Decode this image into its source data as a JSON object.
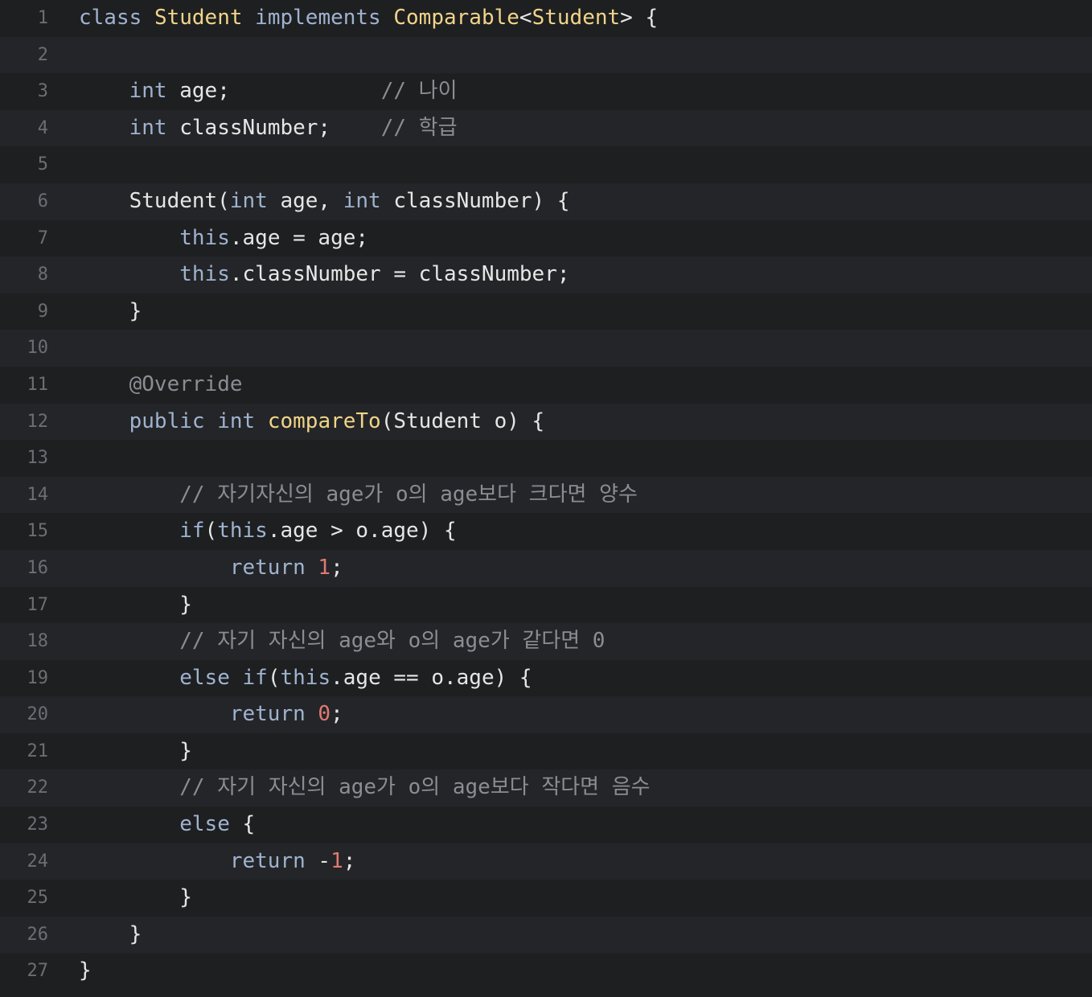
{
  "editor": {
    "language": "java",
    "lines": [
      {
        "n": "1",
        "tokens": [
          {
            "t": "class",
            "c": "kw"
          },
          {
            "t": " ",
            "c": "pl"
          },
          {
            "t": "Student",
            "c": "ty"
          },
          {
            "t": " ",
            "c": "pl"
          },
          {
            "t": "implements",
            "c": "kw"
          },
          {
            "t": " ",
            "c": "pl"
          },
          {
            "t": "Comparable",
            "c": "ty"
          },
          {
            "t": "<",
            "c": "pl"
          },
          {
            "t": "Student",
            "c": "ty"
          },
          {
            "t": "> {",
            "c": "pl"
          }
        ]
      },
      {
        "n": "2",
        "tokens": []
      },
      {
        "n": "3",
        "tokens": [
          {
            "t": "    ",
            "c": "pl"
          },
          {
            "t": "int",
            "c": "kw"
          },
          {
            "t": " age;            ",
            "c": "pl"
          },
          {
            "t": "// 나이",
            "c": "cm"
          }
        ]
      },
      {
        "n": "4",
        "tokens": [
          {
            "t": "    ",
            "c": "pl"
          },
          {
            "t": "int",
            "c": "kw"
          },
          {
            "t": " classNumber;    ",
            "c": "pl"
          },
          {
            "t": "// 학급",
            "c": "cm"
          }
        ]
      },
      {
        "n": "5",
        "tokens": []
      },
      {
        "n": "6",
        "tokens": [
          {
            "t": "    Student(",
            "c": "pl"
          },
          {
            "t": "int",
            "c": "kw"
          },
          {
            "t": " age, ",
            "c": "pl"
          },
          {
            "t": "int",
            "c": "kw"
          },
          {
            "t": " classNumber) {",
            "c": "pl"
          }
        ]
      },
      {
        "n": "7",
        "tokens": [
          {
            "t": "        ",
            "c": "pl"
          },
          {
            "t": "this",
            "c": "kw"
          },
          {
            "t": ".age = age;",
            "c": "pl"
          }
        ]
      },
      {
        "n": "8",
        "tokens": [
          {
            "t": "        ",
            "c": "pl"
          },
          {
            "t": "this",
            "c": "kw"
          },
          {
            "t": ".classNumber = classNumber;",
            "c": "pl"
          }
        ]
      },
      {
        "n": "9",
        "tokens": [
          {
            "t": "    }",
            "c": "pl"
          }
        ]
      },
      {
        "n": "10",
        "tokens": []
      },
      {
        "n": "11",
        "tokens": [
          {
            "t": "    ",
            "c": "pl"
          },
          {
            "t": "@Override",
            "c": "an"
          }
        ]
      },
      {
        "n": "12",
        "tokens": [
          {
            "t": "    ",
            "c": "pl"
          },
          {
            "t": "public",
            "c": "kw"
          },
          {
            "t": " ",
            "c": "pl"
          },
          {
            "t": "int",
            "c": "kw"
          },
          {
            "t": " ",
            "c": "pl"
          },
          {
            "t": "compareTo",
            "c": "fn"
          },
          {
            "t": "(Student o) {",
            "c": "pl"
          }
        ]
      },
      {
        "n": "13",
        "tokens": []
      },
      {
        "n": "14",
        "tokens": [
          {
            "t": "        ",
            "c": "pl"
          },
          {
            "t": "// 자기자신의 age가 o의 age보다 크다면 양수",
            "c": "cm"
          }
        ]
      },
      {
        "n": "15",
        "tokens": [
          {
            "t": "        ",
            "c": "pl"
          },
          {
            "t": "if",
            "c": "kw"
          },
          {
            "t": "(",
            "c": "pl"
          },
          {
            "t": "this",
            "c": "kw"
          },
          {
            "t": ".age > o.age) {",
            "c": "pl"
          }
        ]
      },
      {
        "n": "16",
        "tokens": [
          {
            "t": "            ",
            "c": "pl"
          },
          {
            "t": "return",
            "c": "kw"
          },
          {
            "t": " ",
            "c": "pl"
          },
          {
            "t": "1",
            "c": "nm"
          },
          {
            "t": ";",
            "c": "pl"
          }
        ]
      },
      {
        "n": "17",
        "tokens": [
          {
            "t": "        }",
            "c": "pl"
          }
        ]
      },
      {
        "n": "18",
        "tokens": [
          {
            "t": "        ",
            "c": "pl"
          },
          {
            "t": "// 자기 자신의 age와 o의 age가 같다면 0",
            "c": "cm"
          }
        ]
      },
      {
        "n": "19",
        "tokens": [
          {
            "t": "        ",
            "c": "pl"
          },
          {
            "t": "else",
            "c": "kw"
          },
          {
            "t": " ",
            "c": "pl"
          },
          {
            "t": "if",
            "c": "kw"
          },
          {
            "t": "(",
            "c": "pl"
          },
          {
            "t": "this",
            "c": "kw"
          },
          {
            "t": ".age == o.age) {",
            "c": "pl"
          }
        ]
      },
      {
        "n": "20",
        "tokens": [
          {
            "t": "            ",
            "c": "pl"
          },
          {
            "t": "return",
            "c": "kw"
          },
          {
            "t": " ",
            "c": "pl"
          },
          {
            "t": "0",
            "c": "nm"
          },
          {
            "t": ";",
            "c": "pl"
          }
        ]
      },
      {
        "n": "21",
        "tokens": [
          {
            "t": "        }",
            "c": "pl"
          }
        ]
      },
      {
        "n": "22",
        "tokens": [
          {
            "t": "        ",
            "c": "pl"
          },
          {
            "t": "// 자기 자신의 age가 o의 age보다 작다면 음수",
            "c": "cm"
          }
        ]
      },
      {
        "n": "23",
        "tokens": [
          {
            "t": "        ",
            "c": "pl"
          },
          {
            "t": "else",
            "c": "kw"
          },
          {
            "t": " {",
            "c": "pl"
          }
        ]
      },
      {
        "n": "24",
        "tokens": [
          {
            "t": "            ",
            "c": "pl"
          },
          {
            "t": "return",
            "c": "kw"
          },
          {
            "t": " -",
            "c": "pl"
          },
          {
            "t": "1",
            "c": "nm"
          },
          {
            "t": ";",
            "c": "pl"
          }
        ]
      },
      {
        "n": "25",
        "tokens": [
          {
            "t": "        }",
            "c": "pl"
          }
        ]
      },
      {
        "n": "26",
        "tokens": [
          {
            "t": "    }",
            "c": "pl"
          }
        ]
      },
      {
        "n": "27",
        "tokens": [
          {
            "t": "}",
            "c": "pl"
          }
        ]
      }
    ]
  }
}
